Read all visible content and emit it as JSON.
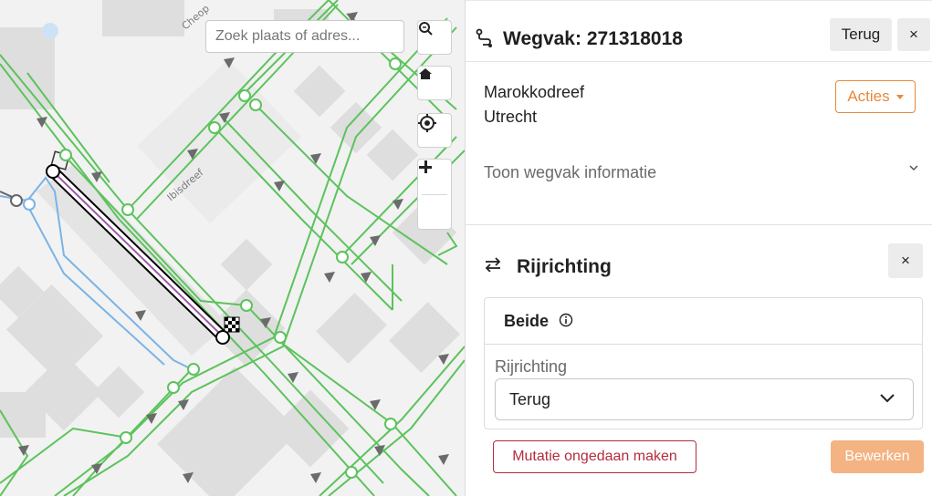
{
  "map": {
    "search_placeholder": "Zoek plaats of adres...",
    "street_labels": [
      "Cheop",
      "Ibisdreef"
    ],
    "colors": {
      "road_green": "#5cc35c",
      "road_blue": "#7bb3e6",
      "selected": "#000000",
      "arrow": "#6b6b6b",
      "building": "#dedede"
    },
    "controls": {
      "zoom_search_icon": "zoom-search-icon",
      "home_icon": "home-icon",
      "locate_icon": "locate-icon",
      "zoom_in_icon": "plus-icon",
      "zoom_out_icon": "minus-icon"
    }
  },
  "panel": {
    "title": "Wegvak: 271318018",
    "back_label": "Terug",
    "close_label": "×",
    "street": "Marokkodreef",
    "city": "Utrecht",
    "actions_label": "Acties",
    "toggle_info_label": "Toon wegvak informatie",
    "section": {
      "title": "Rijrichting",
      "close_label": "×",
      "card_title": "Beide",
      "field_label": "Rijrichting",
      "select_value": "Terug"
    },
    "undo_label": "Mutatie ongedaan maken",
    "edit_label": "Bewerken",
    "accent_color": "#e6893a",
    "danger_color": "#b32d3e"
  }
}
